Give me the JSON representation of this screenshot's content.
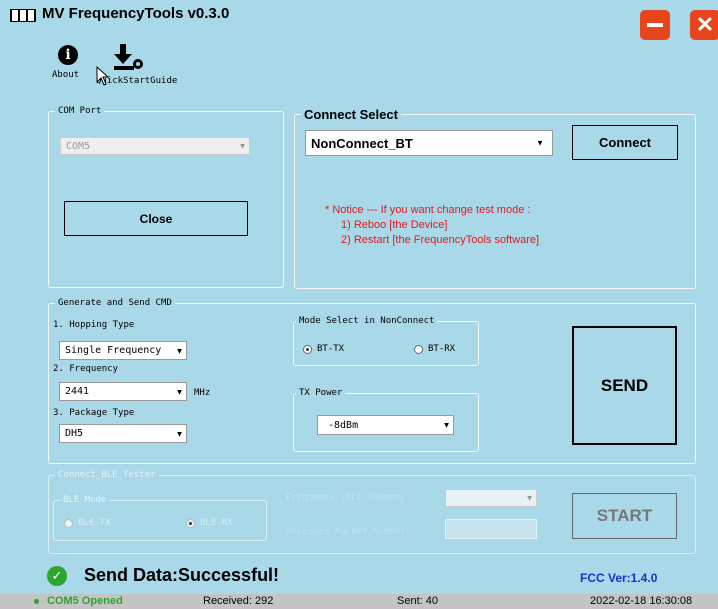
{
  "window": {
    "title": "MV FrequencyTools v0.3.0"
  },
  "toolbar": {
    "about_label": "About",
    "guide_label": "QuickStartGuide"
  },
  "com_port": {
    "legend": "COM Port",
    "port_value": "COM5",
    "close_label": "Close"
  },
  "connect_select": {
    "legend": "Connect Select",
    "mode_value": "NonConnect_BT",
    "connect_label": "Connect",
    "notice": [
      "* Notice --- If you want change test mode :",
      "1) Reboo [the Device]",
      "2) Restart [the FrequencyTools software]"
    ]
  },
  "generate": {
    "legend": "Generate and Send CMD",
    "hopping_label": "1. Hopping Type",
    "hopping_value": "Single Frequency",
    "frequency_label": "2. Frequency",
    "frequency_value": "2441",
    "frequency_unit": "MHz",
    "package_label": "3. Package Type",
    "package_value": "DH5",
    "mode_legend": "Mode Select in NonConnect",
    "radio_bt_tx": "BT-TX",
    "radio_bt_rx": "BT-RX",
    "tx_power_legend": "TX Power",
    "tx_power_value": "-8dBm",
    "send_label": "SEND"
  },
  "ble": {
    "legend": "Connect_BLE_Tester",
    "mode_legend": "BLE Mode",
    "radio_tx": "BLE-TX",
    "radio_rx": "BLE-RX",
    "frequency_label": "Frequency (BLE Tester)",
    "received_label": "Received Packet Number:",
    "start_label": "START"
  },
  "result": {
    "message": "Send Data:Successful!",
    "fcc_version": "FCC Ver:1.4.0"
  },
  "statusbar": {
    "port_status": "COM5 Opened",
    "received": "Received: 292",
    "sent": "Sent: 40",
    "datetime": "2022-02-18 16:30:08"
  },
  "colors": {
    "background": "#a9d8e8",
    "accent_red": "#e8451c",
    "notice_red": "#e01b1b",
    "success_green": "#2ea52e",
    "fcc_blue": "#1a2fd6"
  }
}
